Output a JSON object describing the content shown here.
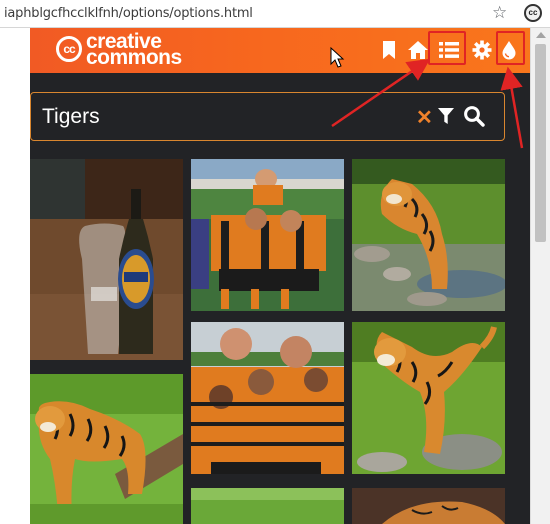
{
  "browser": {
    "url": "iaphblgcfhcclklfnh/options/options.html",
    "bookmark_icon": "star-icon",
    "extension_icon": "cc-extension-icon",
    "extension_label": "cc"
  },
  "header": {
    "logo_mark": "cc",
    "logo_line1": "creative",
    "logo_line2": "commons",
    "icons": [
      "bookmark-icon",
      "home-icon",
      "list-icon",
      "gear-icon",
      "drop-icon"
    ],
    "highlighted_icons": [
      "list-icon",
      "drop-icon"
    ]
  },
  "search": {
    "value": "Tigers",
    "placeholder": "",
    "clear_icon": "close-icon",
    "filter_icon": "filter-icon",
    "search_icon": "search-icon"
  },
  "gallery": {
    "images": [
      {
        "subject": "Tiger beer bottle and glass"
      },
      {
        "subject": "Rugby team celebrating"
      },
      {
        "subject": "Tiger walking through stream"
      },
      {
        "subject": "Rugby team huddle"
      },
      {
        "subject": "Tiger walking on grass"
      },
      {
        "subject": "Tiger standing by log"
      },
      {
        "subject": "Tiger on grass"
      },
      {
        "subject": "Tiger"
      }
    ]
  },
  "colors": {
    "header_orange": "#f7671e",
    "frame_dark": "#222326",
    "search_border": "#d9862f",
    "accent_orange": "#f0822b",
    "annotation_red": "#e02424"
  }
}
